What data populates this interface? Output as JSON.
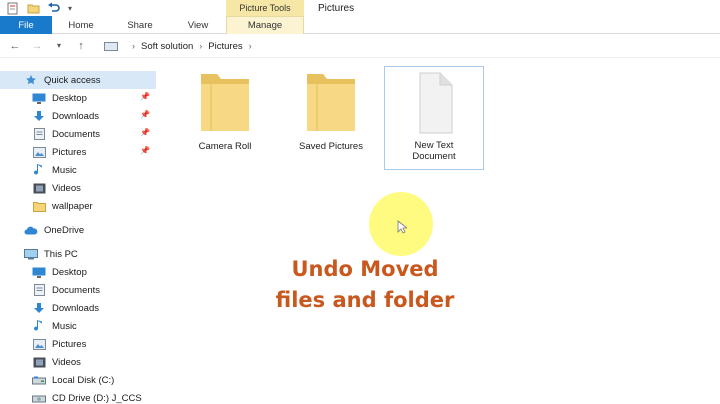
{
  "window": {
    "context_title": "Picture Tools",
    "title": "Pictures"
  },
  "ribbon": {
    "tabs": [
      {
        "label": "File"
      },
      {
        "label": "Home"
      },
      {
        "label": "Share"
      },
      {
        "label": "View"
      },
      {
        "label": "Manage"
      }
    ]
  },
  "address": {
    "breadcrumbs": [
      "Soft solution",
      "Pictures"
    ]
  },
  "nav": {
    "quick_access": "Quick access",
    "qa_items": [
      {
        "label": "Desktop",
        "icon": "desktop-icon",
        "pinned": true
      },
      {
        "label": "Downloads",
        "icon": "downloads-icon",
        "pinned": true
      },
      {
        "label": "Documents",
        "icon": "documents-icon",
        "pinned": true
      },
      {
        "label": "Pictures",
        "icon": "pictures-icon",
        "pinned": true
      },
      {
        "label": "Music",
        "icon": "music-icon",
        "pinned": false
      },
      {
        "label": "Videos",
        "icon": "videos-icon",
        "pinned": false
      },
      {
        "label": "wallpaper",
        "icon": "folder-icon",
        "pinned": false
      }
    ],
    "onedrive": "OneDrive",
    "this_pc": "This PC",
    "pc_items": [
      {
        "label": "Desktop",
        "icon": "desktop-icon"
      },
      {
        "label": "Documents",
        "icon": "documents-icon"
      },
      {
        "label": "Downloads",
        "icon": "downloads-icon"
      },
      {
        "label": "Music",
        "icon": "music-icon"
      },
      {
        "label": "Pictures",
        "icon": "pictures-icon"
      },
      {
        "label": "Videos",
        "icon": "videos-icon"
      },
      {
        "label": "Local Disk (C:)",
        "icon": "drive-icon"
      },
      {
        "label": "CD Drive (D:) J_CCS",
        "icon": "cd-drive-icon"
      }
    ]
  },
  "content": {
    "items": [
      {
        "label": "Camera Roll",
        "type": "folder"
      },
      {
        "label": "Saved Pictures",
        "type": "folder"
      },
      {
        "label": "New Text\nDocument",
        "type": "text-document",
        "selected": true
      }
    ]
  },
  "overlay": {
    "line1": "Undo Moved",
    "line2": "files and folder"
  },
  "colors": {
    "file_tab": "#1979ca",
    "context_tab": "#f7e7a6",
    "caption": "#c9581f",
    "folder": "#f5d47a",
    "cursor_highlight": "#fffb7a"
  }
}
